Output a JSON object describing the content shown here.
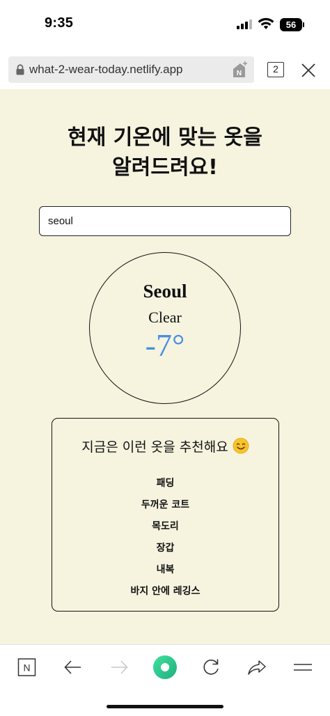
{
  "status_bar": {
    "time": "9:35",
    "battery": "56",
    "icons": [
      "signal-icon",
      "wifi-icon",
      "battery-icon"
    ]
  },
  "browser": {
    "url": "what-2-wear-today.netlify.app",
    "tab_count": "2",
    "icons": [
      "lock-icon",
      "add-to-home-icon",
      "tabs-icon",
      "close-icon"
    ]
  },
  "page": {
    "title_line1": "현재 기온에 맞는 옷을",
    "title_line2": "알려드려요!",
    "search": {
      "value": "seoul",
      "placeholder": ""
    },
    "weather": {
      "city": "Seoul",
      "description": "Clear",
      "temperature": "-7°"
    },
    "recommendation": {
      "header": "지금은 이런 옷을 추천해요",
      "emoji": "smiling-face-icon",
      "items": [
        "패딩",
        "두꺼운 코트",
        "목도리",
        "장갑",
        "내복",
        "바지 안에 레깅스"
      ]
    }
  },
  "toolbar": {
    "items": [
      "naver-home-icon",
      "back-arrow-icon",
      "forward-arrow-icon",
      "green-dot-button-icon",
      "reload-icon",
      "share-icon",
      "menu-icon"
    ]
  },
  "colors": {
    "page_background": "#f6f4df",
    "temperature": "#4a8fe0",
    "accent_green": "#2dc98c"
  }
}
